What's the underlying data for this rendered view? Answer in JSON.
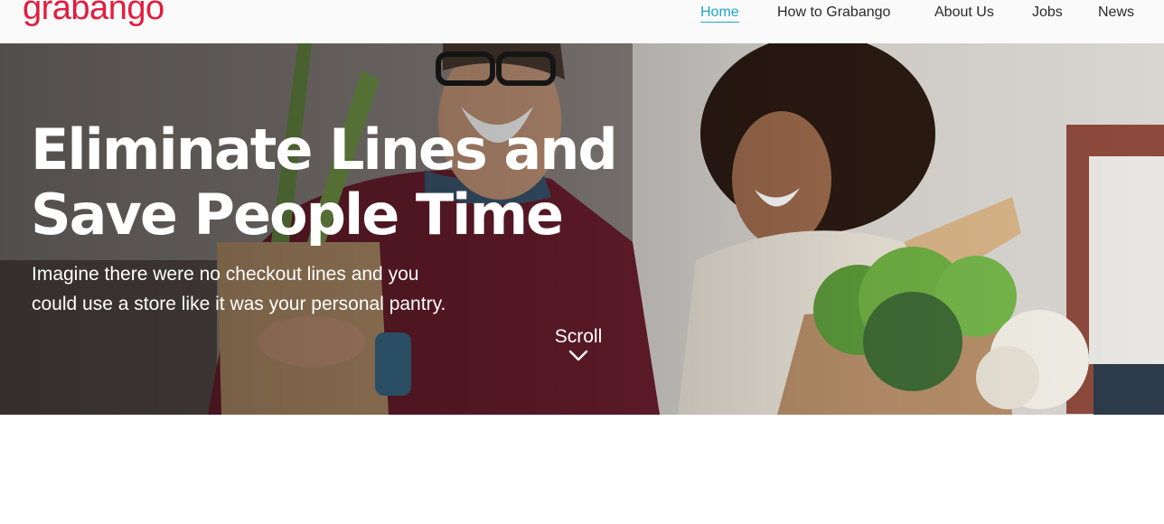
{
  "brand": {
    "name": "grabango",
    "trademark": "®",
    "color": "#e31c3d"
  },
  "nav": {
    "accent": "#1fa8c9",
    "items": [
      {
        "label": "Home",
        "active": true
      },
      {
        "label": "How to Grabango",
        "active": false
      },
      {
        "label": "About Us",
        "active": false
      },
      {
        "label": "Jobs",
        "active": false
      },
      {
        "label": "News",
        "active": false
      }
    ]
  },
  "hero": {
    "title_line1": "Eliminate Lines and",
    "title_line2": "Save People Time",
    "subtitle_line1": "Imagine there were no checkout lines and you",
    "subtitle_line2": "could use a store like it was your personal pantry.",
    "scroll_label": "Scroll",
    "scroll_icon": "chevron-down-icon"
  }
}
